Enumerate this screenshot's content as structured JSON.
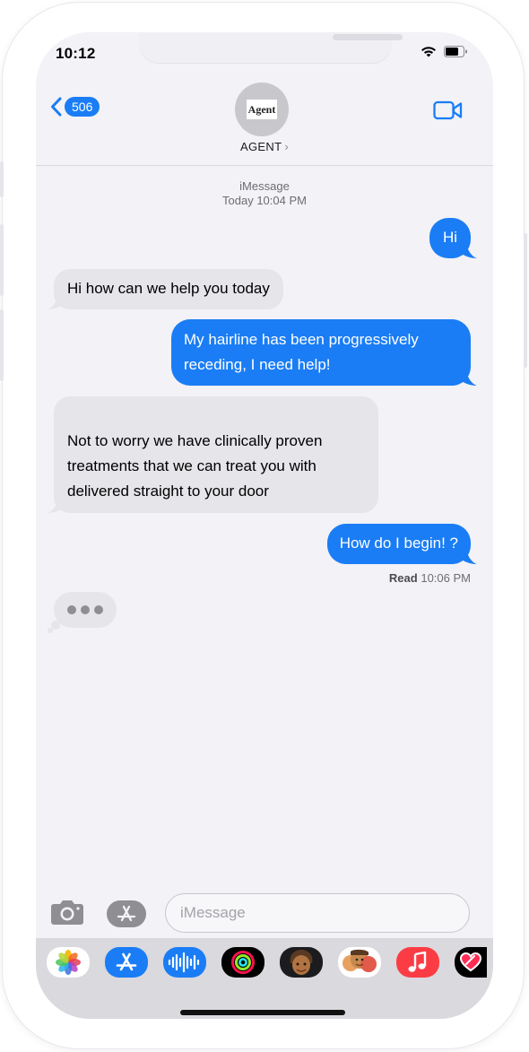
{
  "status_bar": {
    "time": "10:12"
  },
  "header": {
    "back_count": "506",
    "avatar_logo_text": "Agent",
    "contact_name": "AGENT",
    "chevron": "›"
  },
  "conversation": {
    "service": "iMessage",
    "timestamp": "Today 10:04 PM",
    "messages": [
      {
        "from": "me",
        "text": "Hi"
      },
      {
        "from": "them",
        "text": "Hi how can we help you today"
      },
      {
        "from": "me",
        "text": "My hairline has been progressively receding, I need help!"
      },
      {
        "from": "them",
        "text": "Not to worry we have clinically proven treatments that we can treat you with delivered straight to your door"
      },
      {
        "from": "me",
        "text": "How do I begin! ?"
      }
    ],
    "read_label": "Read",
    "read_time": "10:06 PM",
    "typing_indicator": true
  },
  "compose": {
    "placeholder": "iMessage"
  },
  "app_drawer": {
    "apps": [
      "photos-icon",
      "app-store-icon",
      "audio-message-icon",
      "activity-icon",
      "memoji-icon",
      "memoji-stickers-icon",
      "music-icon",
      "digital-touch-icon"
    ]
  },
  "colors": {
    "outgoing_bubble": "#1a7df5",
    "incoming_bubble": "#e5e5ea",
    "background": "#f2f2f7"
  }
}
